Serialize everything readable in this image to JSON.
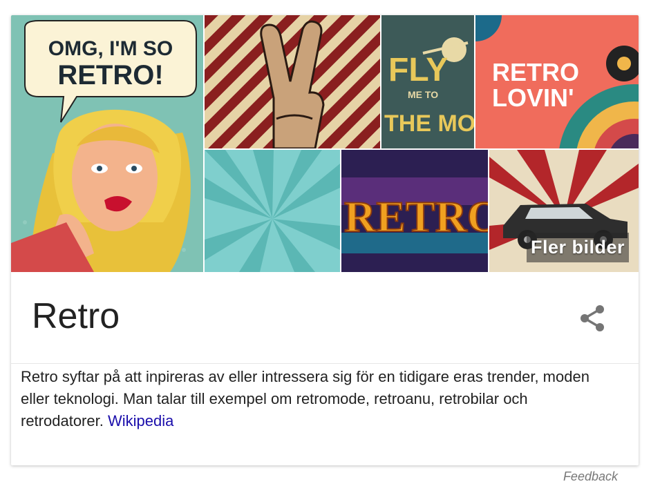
{
  "images": {
    "tile1_caption": "OMG, I'M SO RETRO!",
    "tile3_caption_line1": "FLY",
    "tile3_caption_line2": "ME TO",
    "tile3_caption_line3": "THE MOON",
    "tile4_caption_line1": "RETRO",
    "tile4_caption_line2": "LOVIN'",
    "tile6_caption": "RETRO",
    "more_images_label": "Fler bilder"
  },
  "entity": {
    "title": "Retro"
  },
  "description": {
    "text": "Retro syftar på att inpireras av eller intressera sig för en tidigare eras trender, moden eller teknologi. Man talar till exempel om retromode, retroanu, retrobilar och retrodatorer. ",
    "source_link": "Wikipedia"
  },
  "footer": {
    "feedback": "Feedback"
  },
  "colors": {
    "link": "#1a0dab",
    "title": "#222222",
    "share_icon": "#757575"
  },
  "icons": {
    "share": "share-icon"
  }
}
